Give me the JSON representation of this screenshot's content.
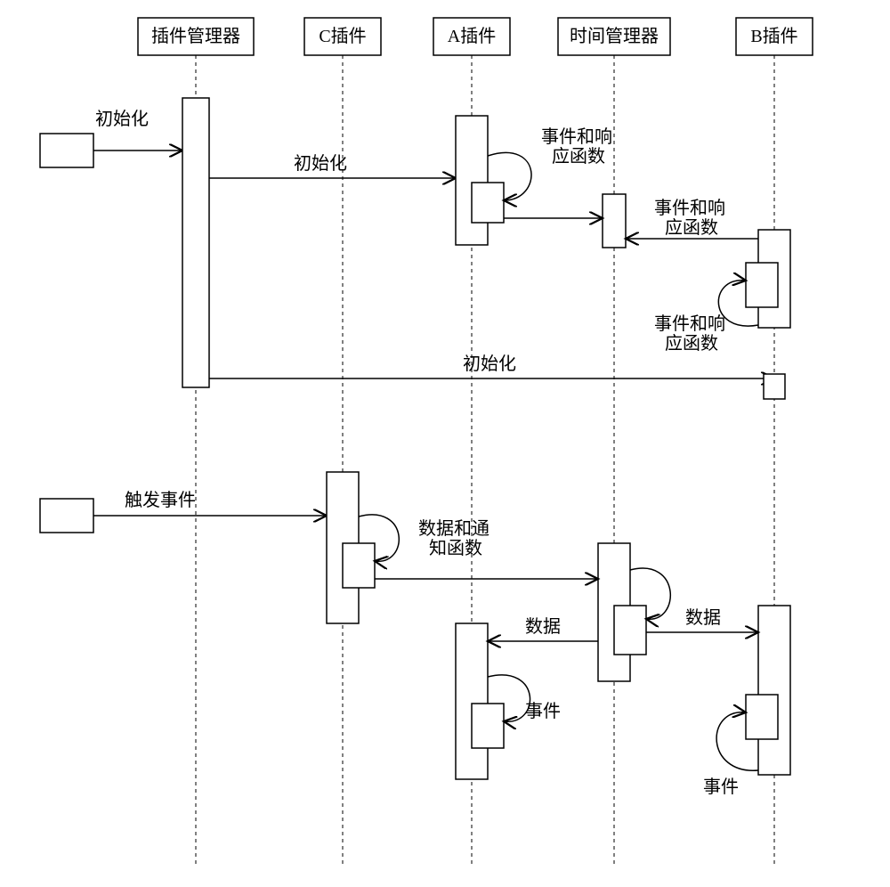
{
  "lifelines": {
    "pluginMgr": "插件管理器",
    "cPlugin": "C插件",
    "aPlugin": "A插件",
    "timeMgr": "时间管理器",
    "bPlugin": "B插件"
  },
  "labels": {
    "init_left": "初始化",
    "init_pm_to_a": "初始化",
    "eventResp1": "事件和响\n应函数",
    "eventResp2": "事件和响\n应函数",
    "eventResp3": "事件和响\n应函数",
    "init_pm_to_b": "初始化",
    "trigger": "触发事件",
    "dataNotify": "数据和通\n知函数",
    "data_to_a": "数据",
    "data_to_b": "数据",
    "event_a": "事件",
    "event_b": "事件"
  }
}
